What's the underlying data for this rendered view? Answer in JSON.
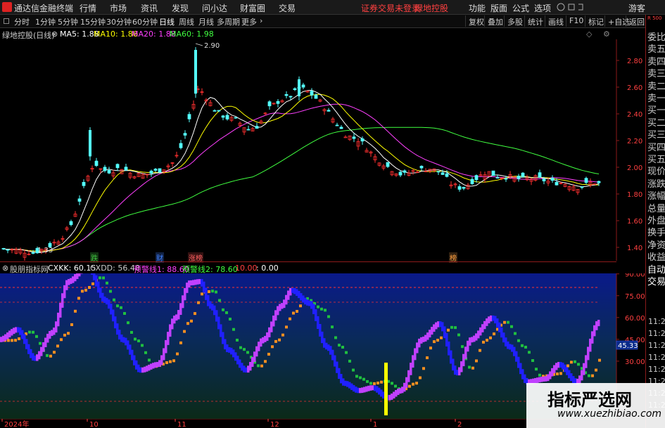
{
  "app": {
    "title": "通达信金融终端",
    "menu": [
      "行情",
      "市场",
      "资讯",
      "发现",
      "问小达",
      "财富圈",
      "交易"
    ],
    "status_warning": "证券交易未登录",
    "stock_name": "绿地控股",
    "right_menu": [
      "功能",
      "版面",
      "公式",
      "选项"
    ],
    "user": "游客"
  },
  "toolbar": {
    "periods": [
      "分时",
      "1分钟",
      "5分钟",
      "15分钟",
      "30分钟",
      "60分钟",
      "日线",
      "周线",
      "月线",
      "多周期",
      "更多"
    ],
    "active_period": "日线",
    "buttons": [
      "复权",
      "叠加",
      "多股",
      "统计",
      "画线",
      "F10",
      "标记",
      "+自选",
      "返回"
    ]
  },
  "main_chart": {
    "title": "绿地控股(日线)",
    "ma_values": [
      {
        "label": "MA5: 1.88",
        "color": "#ffffff"
      },
      {
        "label": "MA10: 1.86",
        "color": "#ffff00"
      },
      {
        "label": "MA20: 1.88",
        "color": "#ff40ff"
      },
      {
        "label": "MA60: 1.98",
        "color": "#40ff40"
      }
    ],
    "y_ticks": [
      "2.80",
      "2.60",
      "2.40",
      "2.20",
      "2.00",
      "1.80",
      "1.60",
      "1.40"
    ],
    "high_label": "2.90",
    "low_label": "1.33",
    "event_markers": [
      {
        "text": "跌",
        "color": "#40c040"
      },
      {
        "text": "财",
        "color": "#4080ff"
      },
      {
        "text": "涨榜",
        "color": "#ff6060"
      },
      {
        "text": "榜",
        "color": "#ffa040"
      }
    ]
  },
  "indicator": {
    "name": "股朋指标网",
    "values": [
      {
        "label": "CXKK: 60.15",
        "color": "#ffffff"
      },
      {
        "label": "CXDD: 56.48",
        "color": "#cccccc"
      },
      {
        "label": "预警线1: 88.60",
        "color": "#ff40ff"
      },
      {
        "label": "预警线2: 78.60",
        "color": "#40ff40"
      },
      {
        "label": "10.00",
        "color": "#ff4040"
      },
      {
        "label": ": 0.00",
        "color": "#ffffff"
      }
    ],
    "y_ticks": [
      "90.00",
      "75.00",
      "60.00",
      "45.00",
      "30.00"
    ],
    "current_value": "45.33"
  },
  "x_axis": {
    "labels": [
      "2024年",
      "10",
      "11",
      "12",
      "1",
      "2"
    ]
  },
  "right_panel": {
    "top_label": "R 500",
    "labels": [
      "委比",
      "卖五",
      "卖四",
      "卖三",
      "卖二",
      "卖一",
      "买一",
      "买二",
      "买三",
      "买四",
      "买五",
      "现价",
      "涨跌",
      "涨幅",
      "总量",
      "外盘",
      "换手",
      "净资",
      "收益",
      "自动",
      "交易"
    ],
    "times": [
      "11:28",
      "11:28",
      "11:28",
      "11:28",
      "11:29",
      "11:29",
      "11:29",
      "11:29"
    ]
  },
  "watermark": {
    "line1": "指标严选网",
    "line2": "www.xuezhibiao.com"
  }
}
